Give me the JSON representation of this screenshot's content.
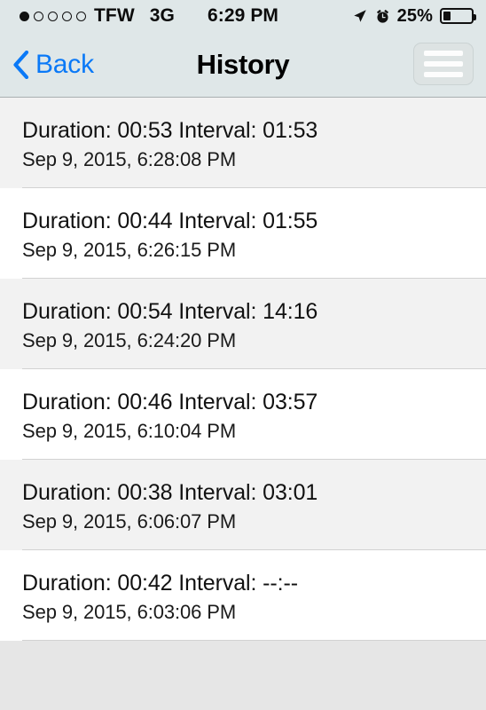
{
  "status_bar": {
    "signal_dots_total": 5,
    "signal_dots_filled": 1,
    "carrier": "TFW",
    "network": "3G",
    "time": "6:29 PM",
    "location_icon": "location-arrow-icon",
    "alarm_icon": "alarm-clock-icon",
    "battery_percent": "25%",
    "battery_level": 25
  },
  "nav_bar": {
    "back_label": "Back",
    "back_icon": "chevron-left-icon",
    "title": "History",
    "menu_icon": "hamburger-menu-icon",
    "tint_color": "#0a79f7"
  },
  "history": {
    "rows": [
      {
        "title": "Duration: 00:53 Interval: 01:53",
        "subtitle": "Sep 9, 2015, 6:28:08 PM"
      },
      {
        "title": "Duration: 00:44 Interval: 01:55",
        "subtitle": "Sep 9, 2015, 6:26:15 PM"
      },
      {
        "title": "Duration: 00:54 Interval: 14:16",
        "subtitle": "Sep 9, 2015, 6:24:20 PM"
      },
      {
        "title": "Duration: 00:46 Interval: 03:57",
        "subtitle": "Sep 9, 2015, 6:10:04 PM"
      },
      {
        "title": "Duration: 00:38 Interval: 03:01",
        "subtitle": "Sep 9, 2015, 6:06:07 PM"
      },
      {
        "title": "Duration: 00:42 Interval: --:--",
        "subtitle": "Sep 9, 2015, 6:03:06 PM"
      }
    ]
  }
}
